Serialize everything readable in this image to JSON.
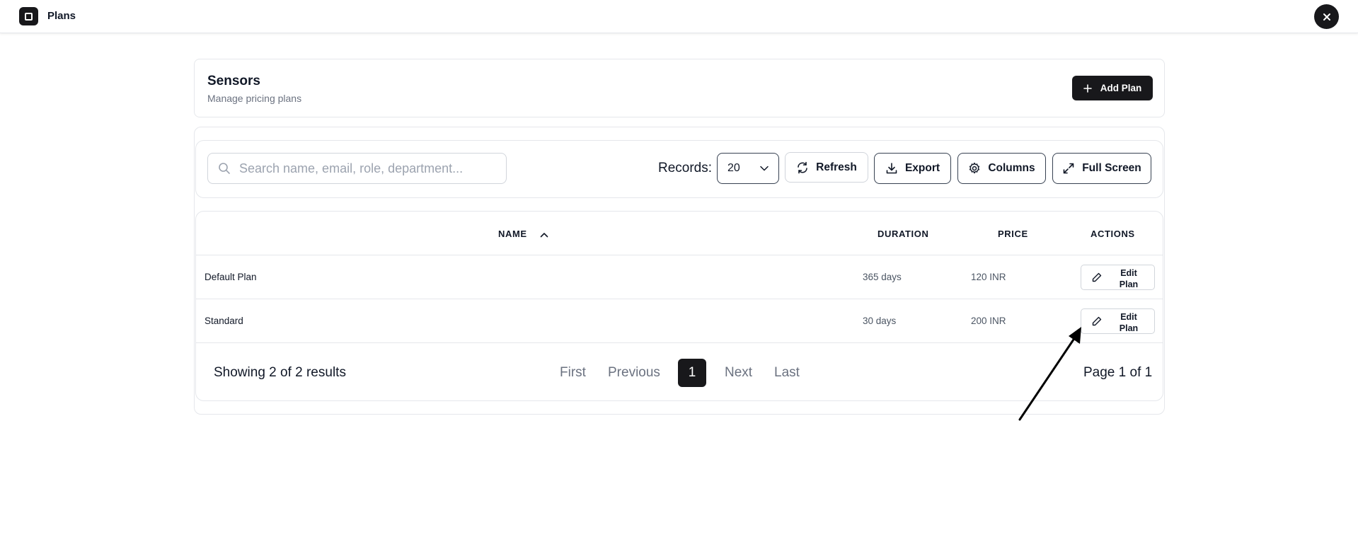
{
  "app": {
    "title": "Plans",
    "icon": "app-square-icon",
    "close_icon": "close-icon"
  },
  "header": {
    "title": "Sensors",
    "subtitle": "Manage pricing plans",
    "add_button": "Add Plan"
  },
  "toolbar": {
    "search_placeholder": "Search name, email, role, department...",
    "search_value": "",
    "records_label": "Records:",
    "records_value": "20",
    "refresh": "Refresh",
    "export": "Export",
    "columns": "Columns",
    "fullscreen": "Full Screen"
  },
  "table": {
    "columns": [
      "NAME",
      "DURATION",
      "PRICE",
      "ACTIONS"
    ],
    "sort": {
      "column": "NAME",
      "direction": "ascending"
    },
    "rows": [
      {
        "name": "Default Plan",
        "duration": "365 days",
        "price": "120 INR",
        "action": "Edit Plan"
      },
      {
        "name": "Standard",
        "duration": "30 days",
        "price": "200 INR",
        "action": "Edit Plan"
      }
    ]
  },
  "pagination": {
    "summary": "Showing 2 of 2 results",
    "first": "First",
    "previous": "Previous",
    "current": "1",
    "next": "Next",
    "last": "Last",
    "page_info": "Page 1 of 1"
  },
  "colors": {
    "primary": "#18181b",
    "border": "#e5e7eb",
    "muted": "#6b7280"
  }
}
